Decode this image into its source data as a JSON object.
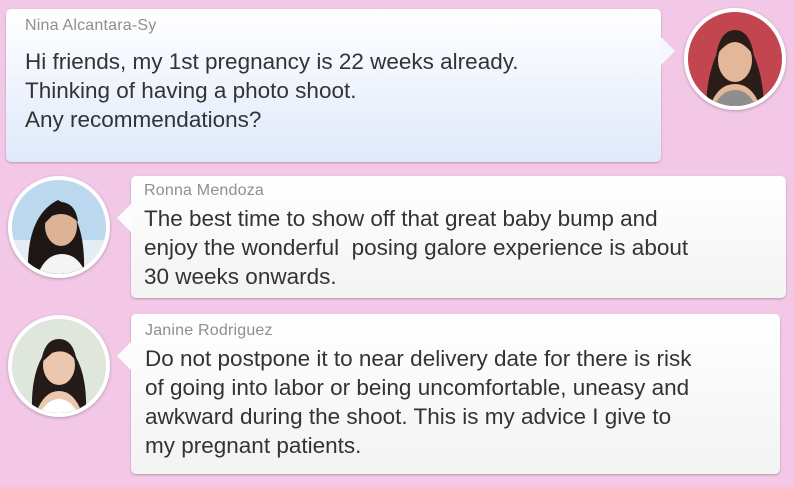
{
  "messages": [
    {
      "author": "Nina Alcantara-Sy",
      "text": "Hi friends, my 1st pregnancy is 22 weeks already.\nThinking of having a photo shoot.\nAny recommendations?"
    },
    {
      "author": "Ronna Mendoza",
      "text": "The best time to show off that great baby bump and\nenjoy the wonderful  posing galore experience is about\n30 weeks onwards."
    },
    {
      "author": "Janine Rodriguez",
      "text": "Do not postpone it to near delivery date for there is risk\nof going into labor or being uncomfortable, uneasy and\nawkward during the shoot. This is my advice I give to\nmy pregnant patients."
    }
  ],
  "colors": {
    "background": "#f2c8e6",
    "author_name": "#8f8f8f",
    "message_text": "#333333"
  }
}
